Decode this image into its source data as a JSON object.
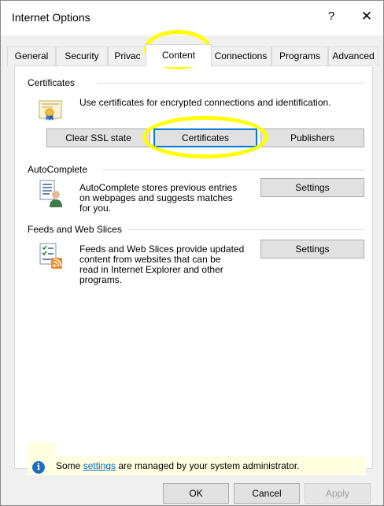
{
  "window": {
    "title": "Internet Options",
    "help_glyph": "?",
    "close_glyph": "✕"
  },
  "tabs": [
    {
      "label": "General"
    },
    {
      "label": "Security"
    },
    {
      "label": "Privac"
    },
    {
      "label": "Content",
      "active": true
    },
    {
      "label": "Connections"
    },
    {
      "label": "Programs"
    },
    {
      "label": "Advanced"
    }
  ],
  "certificates": {
    "group_title": "Certificates",
    "description": "Use certificates for encrypted connections and identification.",
    "clear_ssl_label": "Clear SSL state",
    "certificates_label": "Certificates",
    "publishers_label": "Publishers"
  },
  "autocomplete": {
    "group_title": "AutoComplete",
    "description_line1": "AutoComplete stores previous entries",
    "description_line2": "on webpages and suggests matches",
    "description_line3": "for you.",
    "settings_label": "Settings"
  },
  "feeds": {
    "group_title": "Feeds and Web Slices",
    "description_line1": "Feeds and Web Slices provide updated",
    "description_line2": "content from websites that can be",
    "description_line3": "read in Internet Explorer and other",
    "description_line4": "programs.",
    "settings_label": "Settings"
  },
  "info": {
    "prefix": "Some ",
    "link": "settings",
    "suffix": " are managed by your system administrator."
  },
  "footer": {
    "ok_label": "OK",
    "cancel_label": "Cancel",
    "apply_label": "Apply"
  },
  "colors": {
    "highlight": "#ffff00",
    "focus": "#0078d7",
    "link": "#0066cc",
    "info_background": "#ffffe1"
  }
}
